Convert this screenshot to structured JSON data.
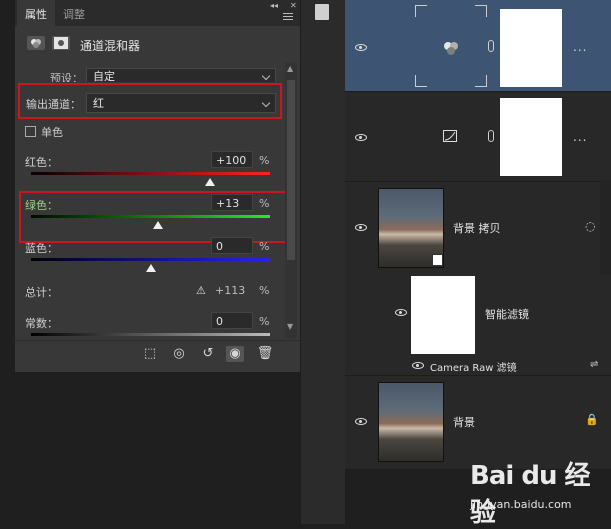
{
  "properties_panel": {
    "tabs": [
      {
        "label": "属性"
      },
      {
        "label": "调整"
      }
    ],
    "title": "通道混和器",
    "preset_label": "预设：",
    "preset_value": "自定",
    "output_channel_label": "输出通道：",
    "output_channel_value": "红",
    "monochrome_label": "单色",
    "sliders": [
      {
        "label": "红色：",
        "value": "+100",
        "unit": "%",
        "level": 100
      },
      {
        "label": "绿色：",
        "value": "+13",
        "unit": "%",
        "level": 13
      },
      {
        "label": "蓝色：",
        "value": "0",
        "unit": "%",
        "level": 0
      }
    ],
    "total_label": "总计：",
    "total_value": "+113",
    "total_unit": "%",
    "constant_label": "常数：",
    "constant_value": "0",
    "constant_unit": "%"
  },
  "layers_panel": {
    "layers": [
      {
        "name": "",
        "type": "channel-mixer-adjustment",
        "selected": true
      },
      {
        "name": "",
        "type": "curves-adjustment",
        "selected": false
      },
      {
        "name": "背景 拷贝",
        "type": "smart-object",
        "selected": false
      },
      {
        "name": "智能滤镜",
        "type": "smart-filter-mask",
        "selected": false
      },
      {
        "name": "Camera Raw 滤镜",
        "type": "filter",
        "selected": false
      },
      {
        "name": "背景",
        "type": "background",
        "selected": false
      }
    ],
    "more_label": "..."
  },
  "watermark": {
    "logo": "Bai du 经验",
    "url": "jingyan.baidu.com"
  },
  "colors": {
    "selection_blue": "#3d5573",
    "highlight_red": "#c9171e"
  }
}
